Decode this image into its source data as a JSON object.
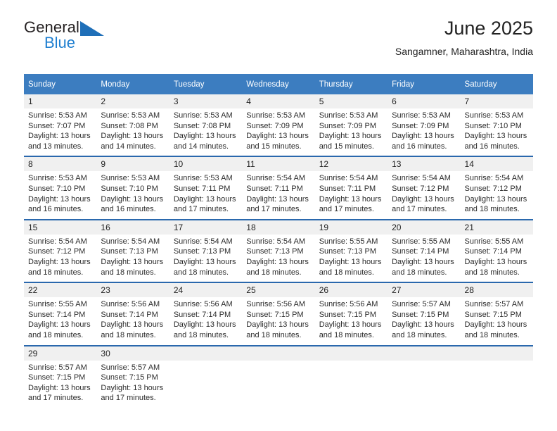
{
  "brand": {
    "name_top": "General",
    "name_bottom": "Blue",
    "triangle_icon": "blue-triangle-icon",
    "accent_color": "#1f7fd0"
  },
  "header": {
    "title": "June 2025",
    "subtitle": "Sangamner, Maharashtra, India"
  },
  "theme": {
    "header_row_bg": "#3c7dc0",
    "day_number_bg": "#f0f0f0",
    "week_divider": "#2a68ad",
    "text": "#222222"
  },
  "calendar": {
    "weekday_headers": [
      "Sunday",
      "Monday",
      "Tuesday",
      "Wednesday",
      "Thursday",
      "Friday",
      "Saturday"
    ],
    "weeks": [
      [
        {
          "day": "1",
          "sunrise": "Sunrise: 5:53 AM",
          "sunset": "Sunset: 7:07 PM",
          "daylight": "Daylight: 13 hours and 13 minutes."
        },
        {
          "day": "2",
          "sunrise": "Sunrise: 5:53 AM",
          "sunset": "Sunset: 7:08 PM",
          "daylight": "Daylight: 13 hours and 14 minutes."
        },
        {
          "day": "3",
          "sunrise": "Sunrise: 5:53 AM",
          "sunset": "Sunset: 7:08 PM",
          "daylight": "Daylight: 13 hours and 14 minutes."
        },
        {
          "day": "4",
          "sunrise": "Sunrise: 5:53 AM",
          "sunset": "Sunset: 7:09 PM",
          "daylight": "Daylight: 13 hours and 15 minutes."
        },
        {
          "day": "5",
          "sunrise": "Sunrise: 5:53 AM",
          "sunset": "Sunset: 7:09 PM",
          "daylight": "Daylight: 13 hours and 15 minutes."
        },
        {
          "day": "6",
          "sunrise": "Sunrise: 5:53 AM",
          "sunset": "Sunset: 7:09 PM",
          "daylight": "Daylight: 13 hours and 16 minutes."
        },
        {
          "day": "7",
          "sunrise": "Sunrise: 5:53 AM",
          "sunset": "Sunset: 7:10 PM",
          "daylight": "Daylight: 13 hours and 16 minutes."
        }
      ],
      [
        {
          "day": "8",
          "sunrise": "Sunrise: 5:53 AM",
          "sunset": "Sunset: 7:10 PM",
          "daylight": "Daylight: 13 hours and 16 minutes."
        },
        {
          "day": "9",
          "sunrise": "Sunrise: 5:53 AM",
          "sunset": "Sunset: 7:10 PM",
          "daylight": "Daylight: 13 hours and 16 minutes."
        },
        {
          "day": "10",
          "sunrise": "Sunrise: 5:53 AM",
          "sunset": "Sunset: 7:11 PM",
          "daylight": "Daylight: 13 hours and 17 minutes."
        },
        {
          "day": "11",
          "sunrise": "Sunrise: 5:54 AM",
          "sunset": "Sunset: 7:11 PM",
          "daylight": "Daylight: 13 hours and 17 minutes."
        },
        {
          "day": "12",
          "sunrise": "Sunrise: 5:54 AM",
          "sunset": "Sunset: 7:11 PM",
          "daylight": "Daylight: 13 hours and 17 minutes."
        },
        {
          "day": "13",
          "sunrise": "Sunrise: 5:54 AM",
          "sunset": "Sunset: 7:12 PM",
          "daylight": "Daylight: 13 hours and 17 minutes."
        },
        {
          "day": "14",
          "sunrise": "Sunrise: 5:54 AM",
          "sunset": "Sunset: 7:12 PM",
          "daylight": "Daylight: 13 hours and 18 minutes."
        }
      ],
      [
        {
          "day": "15",
          "sunrise": "Sunrise: 5:54 AM",
          "sunset": "Sunset: 7:12 PM",
          "daylight": "Daylight: 13 hours and 18 minutes."
        },
        {
          "day": "16",
          "sunrise": "Sunrise: 5:54 AM",
          "sunset": "Sunset: 7:13 PM",
          "daylight": "Daylight: 13 hours and 18 minutes."
        },
        {
          "day": "17",
          "sunrise": "Sunrise: 5:54 AM",
          "sunset": "Sunset: 7:13 PM",
          "daylight": "Daylight: 13 hours and 18 minutes."
        },
        {
          "day": "18",
          "sunrise": "Sunrise: 5:54 AM",
          "sunset": "Sunset: 7:13 PM",
          "daylight": "Daylight: 13 hours and 18 minutes."
        },
        {
          "day": "19",
          "sunrise": "Sunrise: 5:55 AM",
          "sunset": "Sunset: 7:13 PM",
          "daylight": "Daylight: 13 hours and 18 minutes."
        },
        {
          "day": "20",
          "sunrise": "Sunrise: 5:55 AM",
          "sunset": "Sunset: 7:14 PM",
          "daylight": "Daylight: 13 hours and 18 minutes."
        },
        {
          "day": "21",
          "sunrise": "Sunrise: 5:55 AM",
          "sunset": "Sunset: 7:14 PM",
          "daylight": "Daylight: 13 hours and 18 minutes."
        }
      ],
      [
        {
          "day": "22",
          "sunrise": "Sunrise: 5:55 AM",
          "sunset": "Sunset: 7:14 PM",
          "daylight": "Daylight: 13 hours and 18 minutes."
        },
        {
          "day": "23",
          "sunrise": "Sunrise: 5:56 AM",
          "sunset": "Sunset: 7:14 PM",
          "daylight": "Daylight: 13 hours and 18 minutes."
        },
        {
          "day": "24",
          "sunrise": "Sunrise: 5:56 AM",
          "sunset": "Sunset: 7:14 PM",
          "daylight": "Daylight: 13 hours and 18 minutes."
        },
        {
          "day": "25",
          "sunrise": "Sunrise: 5:56 AM",
          "sunset": "Sunset: 7:15 PM",
          "daylight": "Daylight: 13 hours and 18 minutes."
        },
        {
          "day": "26",
          "sunrise": "Sunrise: 5:56 AM",
          "sunset": "Sunset: 7:15 PM",
          "daylight": "Daylight: 13 hours and 18 minutes."
        },
        {
          "day": "27",
          "sunrise": "Sunrise: 5:57 AM",
          "sunset": "Sunset: 7:15 PM",
          "daylight": "Daylight: 13 hours and 18 minutes."
        },
        {
          "day": "28",
          "sunrise": "Sunrise: 5:57 AM",
          "sunset": "Sunset: 7:15 PM",
          "daylight": "Daylight: 13 hours and 18 minutes."
        }
      ],
      [
        {
          "day": "29",
          "sunrise": "Sunrise: 5:57 AM",
          "sunset": "Sunset: 7:15 PM",
          "daylight": "Daylight: 13 hours and 17 minutes."
        },
        {
          "day": "30",
          "sunrise": "Sunrise: 5:57 AM",
          "sunset": "Sunset: 7:15 PM",
          "daylight": "Daylight: 13 hours and 17 minutes."
        },
        {
          "day": "",
          "sunrise": "",
          "sunset": "",
          "daylight": ""
        },
        {
          "day": "",
          "sunrise": "",
          "sunset": "",
          "daylight": ""
        },
        {
          "day": "",
          "sunrise": "",
          "sunset": "",
          "daylight": ""
        },
        {
          "day": "",
          "sunrise": "",
          "sunset": "",
          "daylight": ""
        },
        {
          "day": "",
          "sunrise": "",
          "sunset": "",
          "daylight": ""
        }
      ]
    ]
  }
}
